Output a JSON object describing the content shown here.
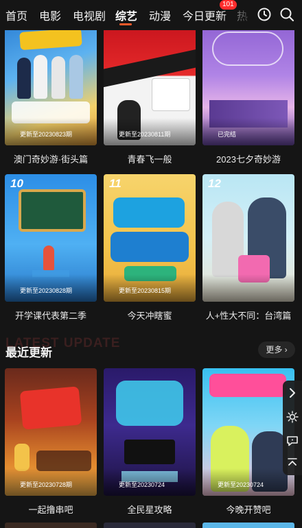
{
  "nav": {
    "tabs": [
      "首页",
      "电影",
      "电视剧",
      "综艺",
      "动漫",
      "今日更新",
      "热"
    ],
    "active_tab": "综艺",
    "badge": "101",
    "icons": [
      "history-icon",
      "search-icon"
    ]
  },
  "hot_row_1": [
    {
      "title": "澳门奇妙游·街头篇",
      "status": "更新至20230823期"
    },
    {
      "title": "青春飞一般",
      "status": "更新至20230811期"
    },
    {
      "title": "2023七夕奇妙游",
      "status": "已完结"
    }
  ],
  "hot_row_2": [
    {
      "rank": "10",
      "title": "开学课代表第二季",
      "status": "更新至20230828期"
    },
    {
      "rank": "11",
      "title": "今天冲瞎蜜",
      "status": "更新至20230815期"
    },
    {
      "rank": "12",
      "title": "人+性大不同：台湾篇",
      "status": ""
    }
  ],
  "latest": {
    "section_title": "最近更新",
    "section_bg_text": "LATEST UPDATE",
    "more_label": "更多 ›",
    "items": [
      {
        "title": "一起撸串吧",
        "status": "更新至20230728期"
      },
      {
        "title": "全民星攻略",
        "status": "更新至20230724"
      },
      {
        "title": "今晚开赞吧",
        "status": "更新至20230724"
      }
    ]
  },
  "side_toolbar": [
    "chevron-right-icon",
    "brightness-icon",
    "comment-icon",
    "scroll-top-icon"
  ],
  "colors": {
    "background": "#151515",
    "accent": "#ff5a2a",
    "badge": "#ff2d2d"
  }
}
